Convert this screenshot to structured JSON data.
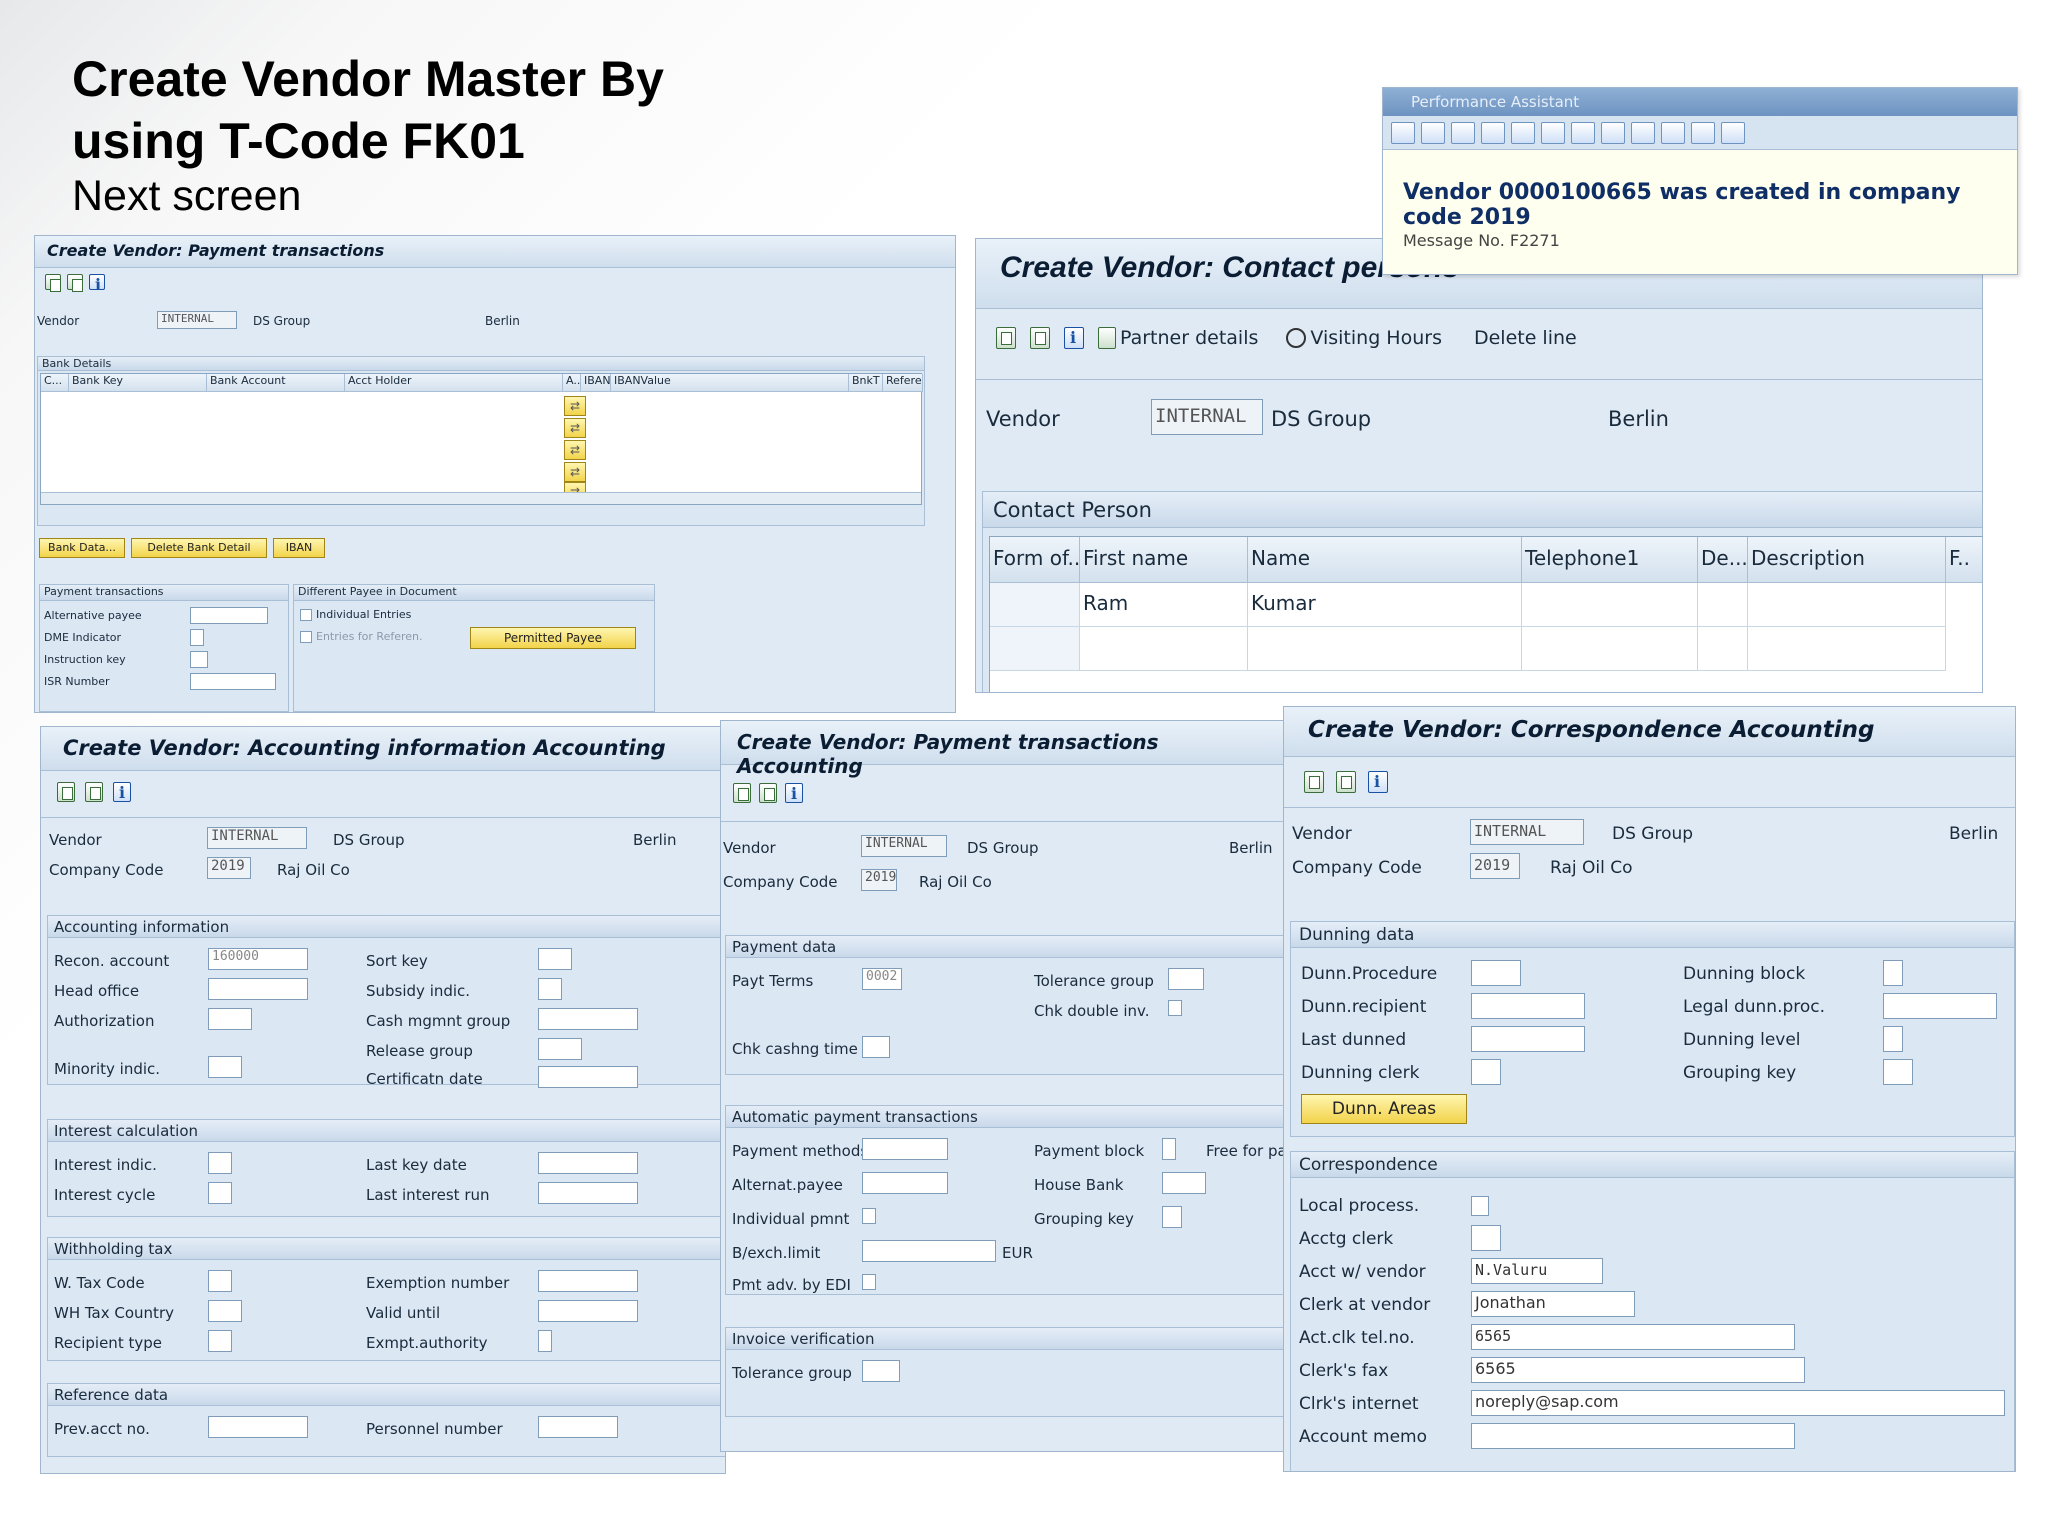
{
  "slide": {
    "title_line1": "Create Vendor Master By",
    "title_line2": "using T-Code FK01",
    "subtitle": "Next screen"
  },
  "perf_assistant": {
    "title": "Performance Assistant",
    "message": "Vendor 0000100665 was created in company code 2019",
    "message_no": "Message No. F2271"
  },
  "vendor": {
    "label": "Vendor",
    "id": "INTERNAL",
    "name": "DS Group",
    "city": "Berlin"
  },
  "company": {
    "label": "Company Code",
    "code": "2019",
    "name": "Raj Oil Co"
  },
  "payment_tx": {
    "title": "Create Vendor: Payment transactions",
    "bank_section": "Bank Details",
    "columns": [
      "C...",
      "Bank Key",
      "Bank Account",
      "Acct Holder",
      "A..",
      "IBAN",
      "IBANValue",
      "BnkT",
      "Referen"
    ],
    "buttons": {
      "bank_data": "Bank Data...",
      "delete_bank": "Delete Bank Detail",
      "iban": "IBAN",
      "permitted_payee": "Permitted Payee"
    },
    "pt_section": "Payment transactions",
    "pt_fields": [
      "Alternative payee",
      "DME Indicator",
      "Instruction key",
      "ISR Number"
    ],
    "diff_section": "Different Payee in Document",
    "diff_fields": [
      "Individual Entries",
      "Entries for Referen."
    ]
  },
  "contact": {
    "title": "Create Vendor: Contact persons",
    "toolbar": {
      "partner": "Partner details",
      "visiting": "Visiting Hours",
      "delete": "Delete line"
    },
    "section": "Contact Person",
    "columns": [
      "Form of...",
      "First name",
      "Name",
      "Telephone1",
      "De...",
      "Description",
      "F.."
    ],
    "rows": [
      {
        "form": "",
        "first": "Ram",
        "name": "Kumar",
        "tel": "",
        "de": "",
        "desc": ""
      }
    ]
  },
  "acct_info": {
    "title": "Create Vendor: Accounting information Accounting",
    "sec_acct": "Accounting information",
    "recon_label": "Recon. account",
    "recon_value": "160000",
    "head_office": "Head office",
    "authorization": "Authorization",
    "minority": "Minority indic.",
    "sort_key": "Sort key",
    "subsidy": "Subsidy indic.",
    "cash_mgmt": "Cash mgmnt group",
    "release_group": "Release group",
    "certif_date": "Certificatn date",
    "sec_interest": "Interest calculation",
    "interest_indic": "Interest indic.",
    "interest_cycle": "Interest cycle",
    "last_key_date": "Last key date",
    "last_interest_run": "Last interest run",
    "sec_wht": "Withholding tax",
    "w_tax_code": "W. Tax Code",
    "wh_tax_country": "WH Tax Country",
    "recipient_type": "Recipient type",
    "exemption_number": "Exemption number",
    "valid_until": "Valid  until",
    "exmpt_authority": "Exmpt.authority",
    "sec_ref": "Reference data",
    "prev_acct": "Prev.acct no.",
    "personnel": "Personnel number"
  },
  "pay_acct": {
    "title": "Create Vendor: Payment transactions Accounting",
    "sec_payment": "Payment data",
    "payt_terms": "Payt Terms",
    "payt_terms_value": "0002",
    "tolerance_group": "Tolerance group",
    "chk_double": "Chk double inv.",
    "chk_cashng": "Chk cashng time",
    "sec_auto": "Automatic payment transactions",
    "payment_methods": "Payment methods",
    "alternat_payee": "Alternat.payee",
    "individual_pmnt": "Individual pmnt",
    "bexch_limit": "B/exch.limit",
    "currency": "EUR",
    "pmt_adv_edi": "Pmt adv. by EDI",
    "payment_block": "Payment block",
    "free_for_pay": "Free for pay",
    "house_bank": "House Bank",
    "grouping_key": "Grouping key",
    "sec_invoice": "Invoice verification",
    "tolerance_group2": "Tolerance group"
  },
  "corresp": {
    "title": "Create Vendor: Correspondence Accounting",
    "sec_dunning": "Dunning data",
    "dunn_procedure": "Dunn.Procedure",
    "dunn_recipient": "Dunn.recipient",
    "last_dunned": "Last dunned",
    "dunning_clerk": "Dunning clerk",
    "dunning_block": "Dunning block",
    "legal_dunn": "Legal dunn.proc.",
    "dunning_level": "Dunning level",
    "grouping_key": "Grouping key",
    "dunn_areas_btn": "Dunn. Areas",
    "sec_corr": "Correspondence",
    "local_process": "Local process.",
    "acctg_clerk": "Acctg clerk",
    "acct_w_vendor": "Acct w/ vendor",
    "acct_w_vendor_value": "N.Valuru",
    "clerk_at_vendor": "Clerk at vendor",
    "clerk_at_vendor_value": "Jonathan",
    "act_clk_tel": "Act.clk tel.no.",
    "act_clk_tel_value": "6565",
    "clerks_fax": "Clerk's fax",
    "clerks_fax_value": "6565",
    "clrks_internet": "Clrk's internet",
    "clrks_internet_value": "noreply@sap.com",
    "account_memo": "Account memo"
  }
}
